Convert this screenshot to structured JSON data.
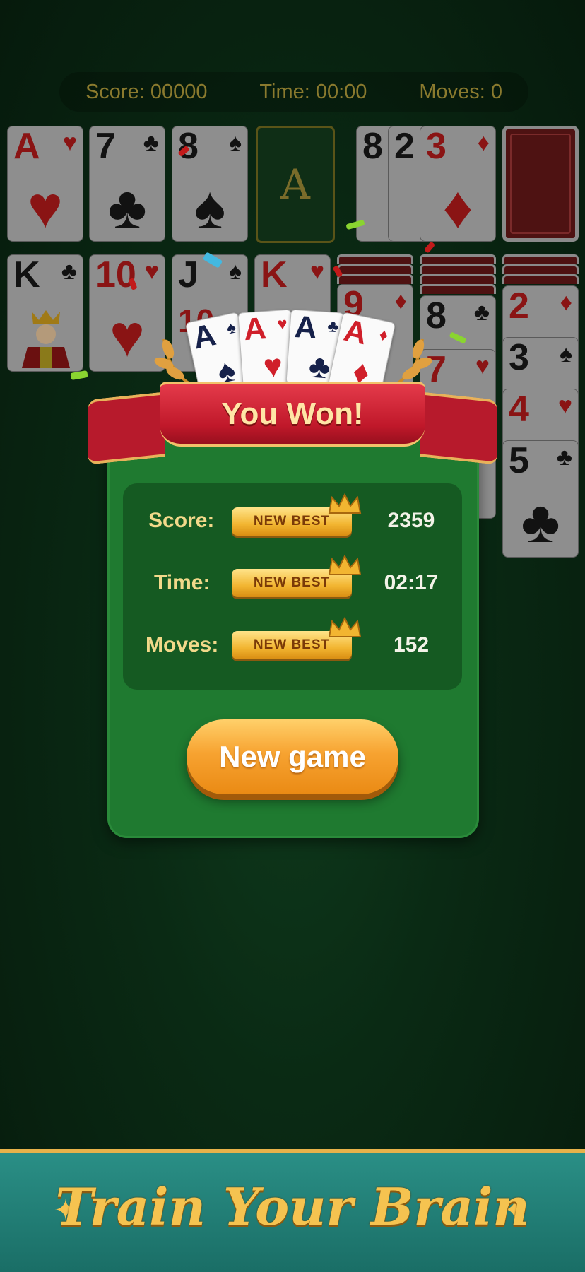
{
  "hud": {
    "score": "Score: 00000",
    "time": "Time: 00:00",
    "moves": "Moves: 0"
  },
  "top_row": {
    "card1": {
      "rank": "A",
      "suit": "♥"
    },
    "card2": {
      "rank": "7",
      "suit": "♣"
    },
    "card3": {
      "rank": "8",
      "suit": "♠"
    },
    "foundation_label": "A",
    "card4": {
      "rank": "8",
      "suit": "♣"
    },
    "card5": {
      "rank": "2",
      "suit": "♠"
    },
    "card6": {
      "rank": "3",
      "suit": "♦"
    }
  },
  "tableau": {
    "col1": {
      "rank": "K",
      "suit": "♣"
    },
    "col2": {
      "rank": "10",
      "suit": "♥"
    },
    "col3_top": {
      "rank": "J",
      "suit": "♠"
    },
    "col3_under": {
      "rank": "10"
    },
    "col4": {
      "rank": "K",
      "suit": "♥"
    },
    "col5": {
      "rank": "9",
      "suit": "♦"
    },
    "col6a": {
      "rank": "8",
      "suit": "♣"
    },
    "col6b": {
      "rank": "7",
      "suit": "♥"
    },
    "col7a": {
      "rank": "2",
      "suit": "♦"
    },
    "col7b": {
      "rank": "3",
      "suit": "♠"
    },
    "col7c": {
      "rank": "4",
      "suit": "♥"
    },
    "col7d": {
      "rank": "5",
      "suit": "♣"
    }
  },
  "fan_cards": [
    {
      "rank": "A",
      "suit": "♠"
    },
    {
      "rank": "A",
      "suit": "♥"
    },
    {
      "rank": "A",
      "suit": "♣"
    },
    {
      "rank": "A",
      "suit": "♦"
    }
  ],
  "popup": {
    "title": "You Won!",
    "score_label": "Score:",
    "time_label": "Time:",
    "moves_label": "Moves:",
    "badge": "NEW BEST",
    "score_value": "2359",
    "time_value": "02:17",
    "moves_value": "152",
    "new_game_label": "New game"
  },
  "footer": {
    "slogan": "Train Your Brain"
  },
  "colors": {
    "felt": "#0a2a14",
    "panel": "#1f7a30",
    "accent": "#f7a331",
    "ribbon": "#c0182a",
    "footer": "#2a8f86"
  }
}
